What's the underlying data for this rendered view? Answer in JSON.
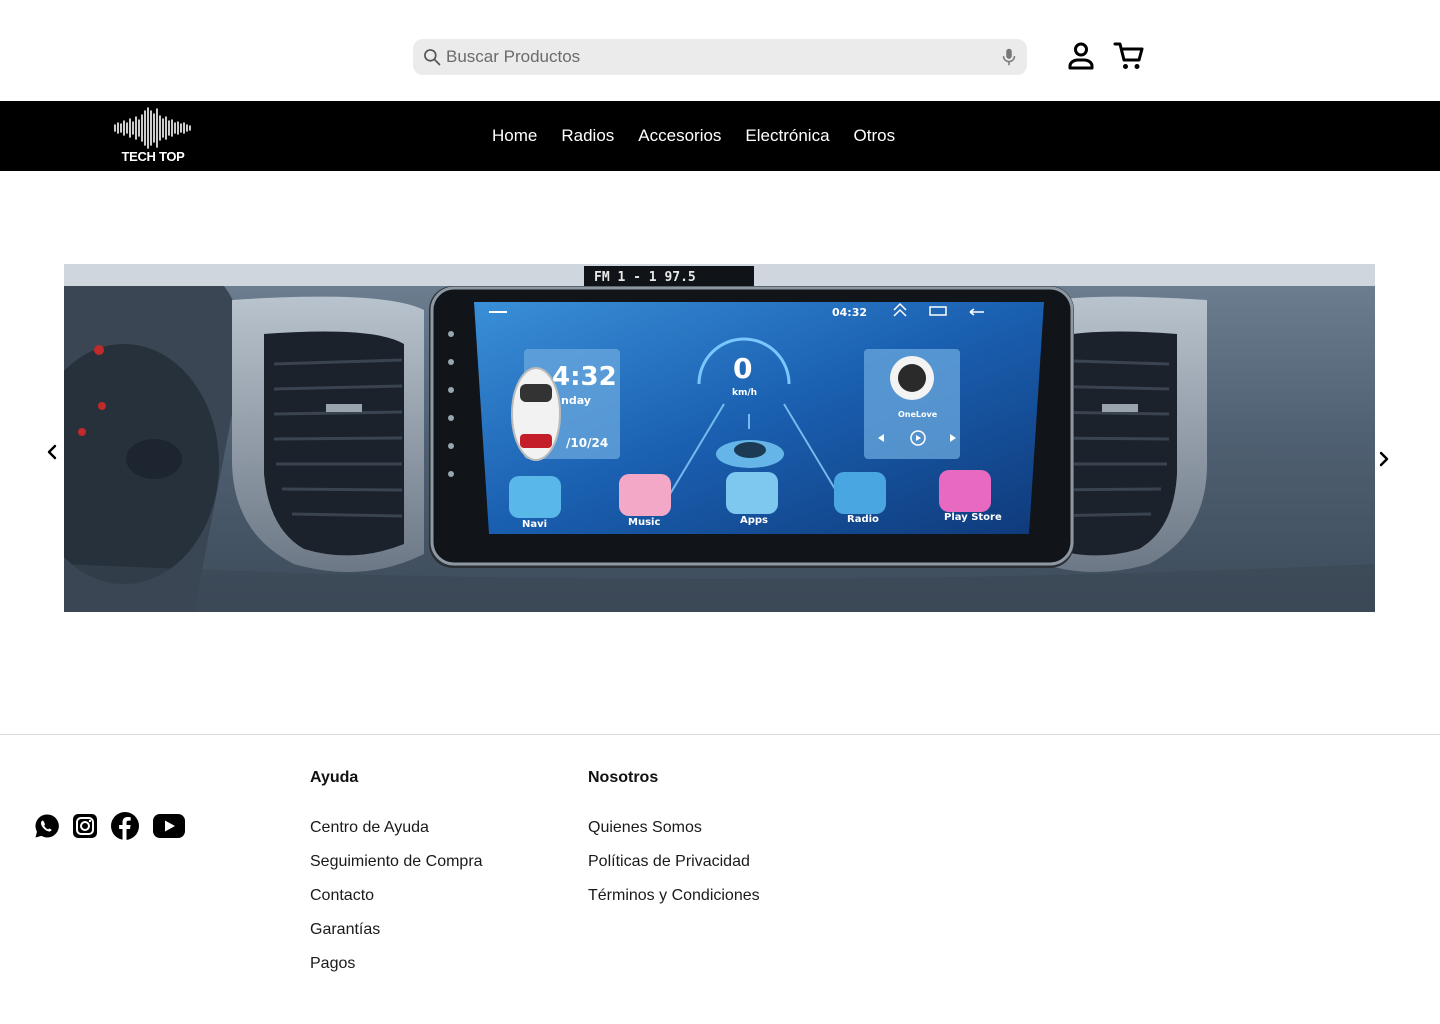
{
  "header": {
    "search": {
      "placeholder": "Buscar Productos",
      "search_icon": "search-icon",
      "mic_icon": "microphone-icon"
    },
    "account_icon": "user-icon",
    "cart_icon": "cart-icon"
  },
  "nav": {
    "logo_text": "TECH TOP",
    "items": [
      {
        "label": "Home"
      },
      {
        "label": "Radios"
      },
      {
        "label": "Accesorios"
      },
      {
        "label": "Electrónica"
      },
      {
        "label": "Otros"
      }
    ]
  },
  "carousel": {
    "prev_icon": "chevron-left-icon",
    "next_icon": "chevron-right-icon",
    "slide": {
      "dash_text": "FM 1 - 1     97.5",
      "clock": "4:32",
      "day": "nday",
      "date": "/10/24",
      "speed": "0",
      "speed_unit": "km/h",
      "status_time": "04:32",
      "music_caption": "OneLove",
      "apps": [
        {
          "label": "Navi"
        },
        {
          "label": "Music"
        },
        {
          "label": "Apps"
        },
        {
          "label": "Radio"
        },
        {
          "label": "Play Store"
        }
      ]
    }
  },
  "footer": {
    "socials": [
      {
        "icon": "whatsapp-icon"
      },
      {
        "icon": "instagram-icon"
      },
      {
        "icon": "facebook-icon"
      },
      {
        "icon": "youtube-icon"
      }
    ],
    "help": {
      "title": "Ayuda",
      "links": [
        {
          "label": "Centro de Ayuda"
        },
        {
          "label": "Seguimiento de Compra"
        },
        {
          "label": "Contacto"
        },
        {
          "label": "Garantías"
        },
        {
          "label": "Pagos"
        }
      ]
    },
    "about": {
      "title": "Nosotros",
      "links": [
        {
          "label": "Quienes Somos"
        },
        {
          "label": "Políticas de Privacidad"
        },
        {
          "label": "Términos y Condiciones"
        }
      ]
    }
  }
}
